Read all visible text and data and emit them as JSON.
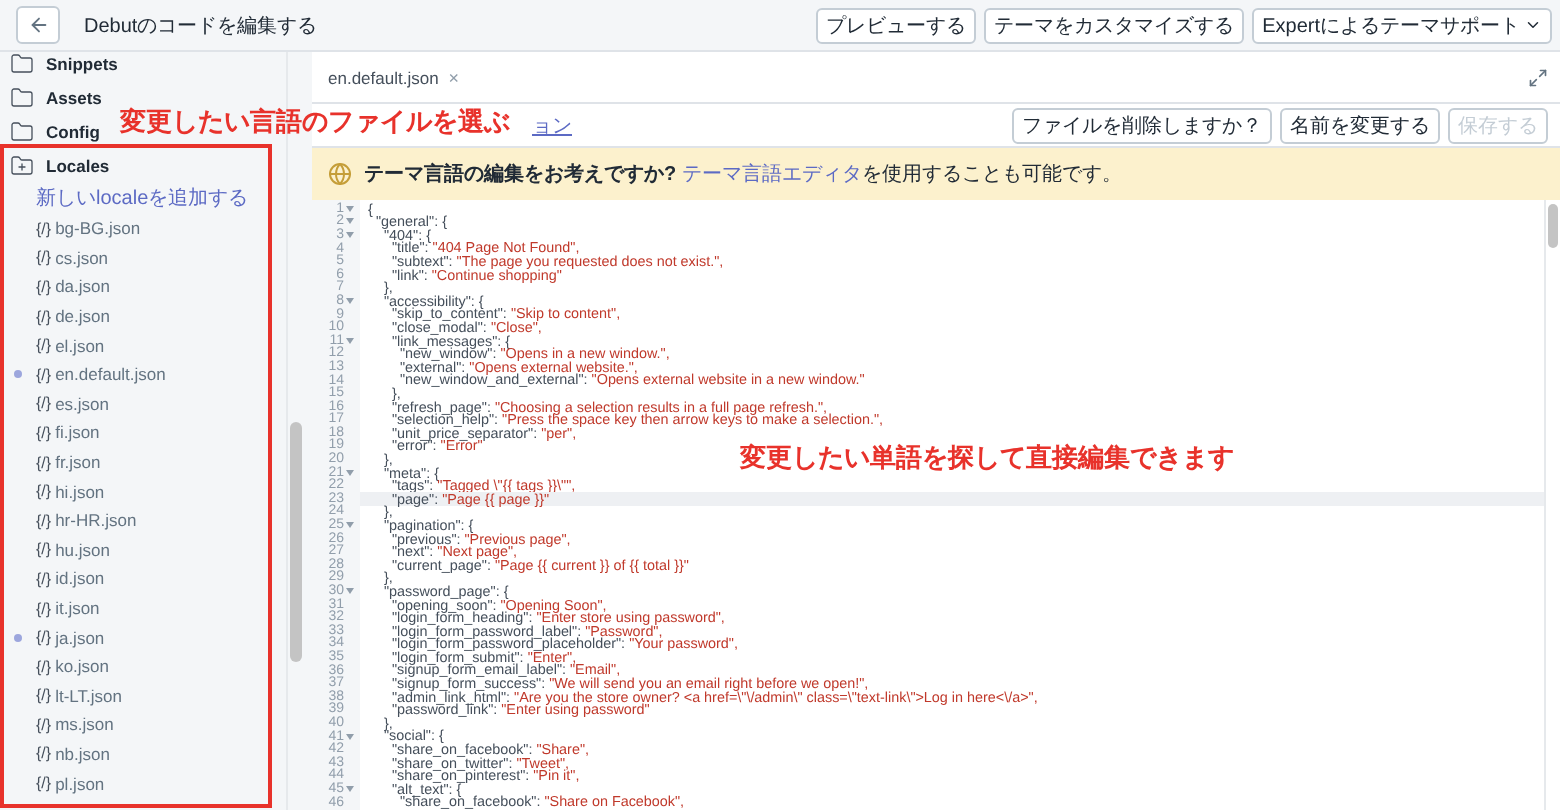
{
  "top_bar": {
    "title": "Debutのコードを編集する",
    "buttons": [
      {
        "label": "プレビューする",
        "caret": false
      },
      {
        "label": "テーマをカスタマイズする",
        "caret": false
      },
      {
        "label": "Expertによるテーマサポート",
        "caret": true
      }
    ]
  },
  "sidebar": {
    "folders": [
      {
        "name": "Snippets",
        "expanded": false
      },
      {
        "name": "Assets",
        "expanded": false
      },
      {
        "name": "Config",
        "expanded": false
      },
      {
        "name": "Locales",
        "expanded": true
      }
    ],
    "add_link": "新しいlocaleを追加する",
    "files": [
      {
        "icon": "{/}",
        "name": "bg-BG.json",
        "modified": false
      },
      {
        "icon": "{/}",
        "name": "cs.json",
        "modified": false
      },
      {
        "icon": "{/}",
        "name": "da.json",
        "modified": false
      },
      {
        "icon": "{/}",
        "name": "de.json",
        "modified": false
      },
      {
        "icon": "{/}",
        "name": "el.json",
        "modified": false
      },
      {
        "icon": "{/}",
        "name": "en.default.json",
        "modified": true
      },
      {
        "icon": "{/}",
        "name": "es.json",
        "modified": false
      },
      {
        "icon": "{/}",
        "name": "fi.json",
        "modified": false
      },
      {
        "icon": "{/}",
        "name": "fr.json",
        "modified": false
      },
      {
        "icon": "{/}",
        "name": "hi.json",
        "modified": false
      },
      {
        "icon": "{/}",
        "name": "hr-HR.json",
        "modified": false
      },
      {
        "icon": "{/}",
        "name": "hu.json",
        "modified": false
      },
      {
        "icon": "{/}",
        "name": "id.json",
        "modified": false
      },
      {
        "icon": "{/}",
        "name": "it.json",
        "modified": false
      },
      {
        "icon": "{/}",
        "name": "ja.json",
        "modified": true
      },
      {
        "icon": "{/}",
        "name": "ko.json",
        "modified": false
      },
      {
        "icon": "{/}",
        "name": "lt-LT.json",
        "modified": false
      },
      {
        "icon": "{/}",
        "name": "ms.json",
        "modified": false
      },
      {
        "icon": "{/}",
        "name": "nb.json",
        "modified": false
      },
      {
        "icon": "{/}",
        "name": "pl.json",
        "modified": false
      }
    ]
  },
  "editor": {
    "tabs": [
      {
        "label": "en.default.json",
        "close": "×",
        "selected": true
      }
    ],
    "older_versions_link": "ョン",
    "actions": [
      {
        "label": "ファイルを削除しますか？",
        "disabled": false
      },
      {
        "label": "名前を変更する",
        "disabled": false
      },
      {
        "label": "保存する",
        "disabled": true
      }
    ],
    "banner": {
      "text": "**テーマ言語の編集をお考えですか?** ",
      "link": "テーマ言語エディタ",
      "text_after": "を使用することも可能です。"
    },
    "code": {
      "lines": [
        {
          "n": "1",
          "fold": true,
          "active": false,
          "code": "{"
        },
        {
          "n": "2",
          "fold": true,
          "active": false,
          "code": "  \"general\": {"
        },
        {
          "n": "3",
          "fold": true,
          "active": false,
          "code": "    \"404\": {"
        },
        {
          "n": "4",
          "fold": false,
          "active": false,
          "code": "      \"title\": ",
          "value": "\"404 Page Not Found\","
        },
        {
          "n": "5",
          "fold": false,
          "active": false,
          "code": "      \"subtext\": ",
          "value": "\"The page you requested does not exist.\","
        },
        {
          "n": "6",
          "fold": false,
          "active": false,
          "code": "      \"link\": ",
          "value": "\"Continue shopping\""
        },
        {
          "n": "7",
          "fold": false,
          "active": false,
          "code": "    },"
        },
        {
          "n": "8",
          "fold": true,
          "active": false,
          "code": "    \"accessibility\": {"
        },
        {
          "n": "9",
          "fold": false,
          "active": false,
          "code": "      \"skip_to_content\": ",
          "value": "\"Skip to content\","
        },
        {
          "n": "10",
          "fold": false,
          "active": false,
          "code": "      \"close_modal\": ",
          "value": "\"Close\","
        },
        {
          "n": "11",
          "fold": true,
          "active": false,
          "code": "      \"link_messages\": {"
        },
        {
          "n": "12",
          "fold": false,
          "active": false,
          "code": "        \"new_window\": ",
          "value": "\"Opens in a new window.\","
        },
        {
          "n": "13",
          "fold": false,
          "active": false,
          "code": "        \"external\": ",
          "value": "\"Opens external website.\","
        },
        {
          "n": "14",
          "fold": false,
          "active": false,
          "code": "        \"new_window_and_external\": ",
          "value": "\"Opens external website in a new window.\""
        },
        {
          "n": "15",
          "fold": false,
          "active": false,
          "code": "      },"
        },
        {
          "n": "16",
          "fold": false,
          "active": false,
          "code": "      \"refresh_page\": ",
          "value": "\"Choosing a selection results in a full page refresh.\","
        },
        {
          "n": "17",
          "fold": false,
          "active": false,
          "code": "      \"selection_help\": ",
          "value": "\"Press the space key then arrow keys to make a selection.\","
        },
        {
          "n": "18",
          "fold": false,
          "active": false,
          "code": "      \"unit_price_separator\": ",
          "value": "\"per\","
        },
        {
          "n": "19",
          "fold": false,
          "active": false,
          "code": "      \"error\": ",
          "value": "\"Error\""
        },
        {
          "n": "20",
          "fold": false,
          "active": false,
          "code": "    },"
        },
        {
          "n": "21",
          "fold": true,
          "active": false,
          "code": "    \"meta\": {"
        },
        {
          "n": "22",
          "fold": false,
          "active": false,
          "code": "      \"tags\": ",
          "value": "\"Tagged \\\"{{ tags }}\\\"\","
        },
        {
          "n": "23",
          "fold": false,
          "active": true,
          "code": "      \"page\": ",
          "value": "\"Page {{ page }}\""
        },
        {
          "n": "24",
          "fold": false,
          "active": false,
          "code": "    },"
        },
        {
          "n": "25",
          "fold": true,
          "active": false,
          "code": "    \"pagination\": {"
        },
        {
          "n": "26",
          "fold": false,
          "active": false,
          "code": "      \"previous\": ",
          "value": "\"Previous page\","
        },
        {
          "n": "27",
          "fold": false,
          "active": false,
          "code": "      \"next\": ",
          "value": "\"Next page\","
        },
        {
          "n": "28",
          "fold": false,
          "active": false,
          "code": "      \"current_page\": ",
          "value": "\"Page {{ current }} of {{ total }}\""
        },
        {
          "n": "29",
          "fold": false,
          "active": false,
          "code": "    },"
        },
        {
          "n": "30",
          "fold": true,
          "active": false,
          "code": "    \"password_page\": {"
        },
        {
          "n": "31",
          "fold": false,
          "active": false,
          "code": "      \"opening_soon\": ",
          "value": "\"Opening Soon\","
        },
        {
          "n": "32",
          "fold": false,
          "active": false,
          "code": "      \"login_form_heading\": ",
          "value": "\"Enter store using password\","
        },
        {
          "n": "33",
          "fold": false,
          "active": false,
          "code": "      \"login_form_password_label\": ",
          "value": "\"Password\","
        },
        {
          "n": "34",
          "fold": false,
          "active": false,
          "code": "      \"login_form_password_placeholder\": ",
          "value": "\"Your password\","
        },
        {
          "n": "35",
          "fold": false,
          "active": false,
          "code": "      \"login_form_submit\": ",
          "value": "\"Enter\","
        },
        {
          "n": "36",
          "fold": false,
          "active": false,
          "code": "      \"signup_form_email_label\": ",
          "value": "\"Email\","
        },
        {
          "n": "37",
          "fold": false,
          "active": false,
          "code": "      \"signup_form_success\": ",
          "value": "\"We will send you an email right before we open!\","
        },
        {
          "n": "38",
          "fold": false,
          "active": false,
          "code": "      \"admin_link_html\": ",
          "value": "\"Are you the store owner? <a href=\\\"\\/admin\\\" class=\\\"text-link\\\">Log in here<\\/a>\","
        },
        {
          "n": "39",
          "fold": false,
          "active": false,
          "code": "      \"password_link\": ",
          "value": "\"Enter using password\""
        },
        {
          "n": "40",
          "fold": false,
          "active": false,
          "code": "    },"
        },
        {
          "n": "41",
          "fold": true,
          "active": false,
          "code": "    \"social\": {"
        },
        {
          "n": "42",
          "fold": false,
          "active": false,
          "code": "      \"share_on_facebook\": ",
          "value": "\"Share\","
        },
        {
          "n": "43",
          "fold": false,
          "active": false,
          "code": "      \"share_on_twitter\": ",
          "value": "\"Tweet\","
        },
        {
          "n": "44",
          "fold": false,
          "active": false,
          "code": "      \"share_on_pinterest\": ",
          "value": "\"Pin it\","
        },
        {
          "n": "45",
          "fold": true,
          "active": false,
          "code": "      \"alt_text\": {"
        },
        {
          "n": "46",
          "fold": false,
          "active": false,
          "code": "        \"share_on_facebook\": ",
          "value": "\"Share on Facebook\","
        }
      ]
    }
  },
  "annotations": [
    {
      "text": "変更したい言語のファイルを選ぶ"
    },
    {
      "text": "変更したい単語を探して直接編集できます"
    }
  ]
}
